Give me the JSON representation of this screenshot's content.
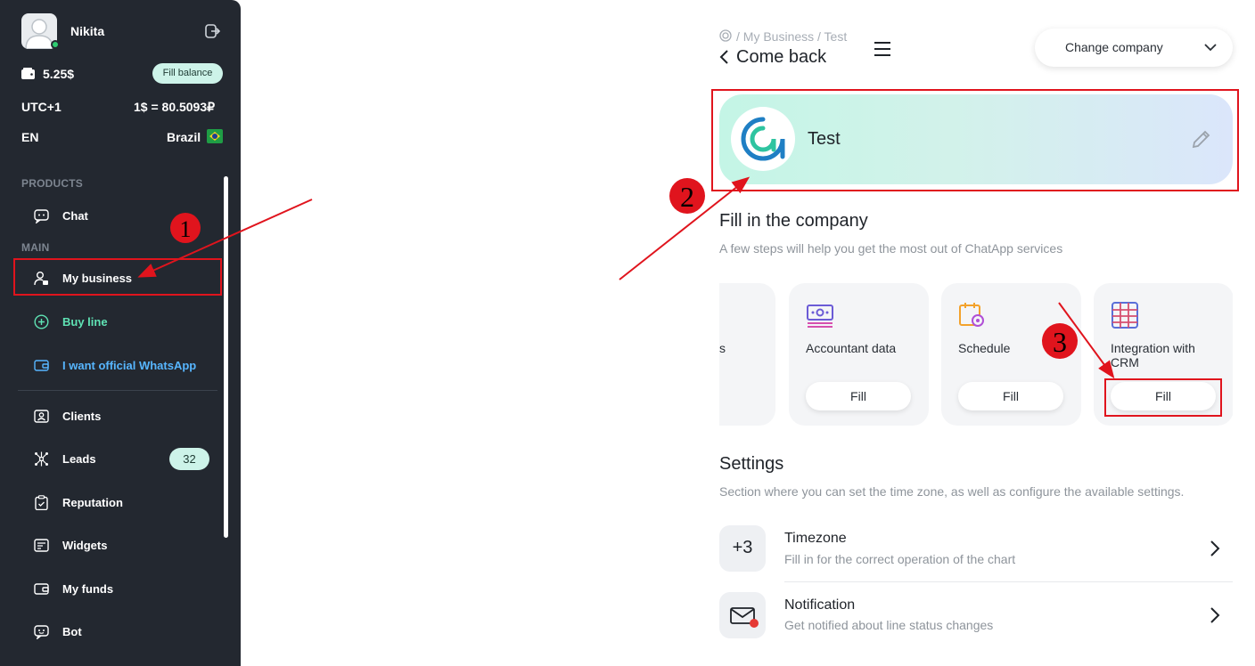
{
  "sidebar": {
    "user": {
      "name": "Nikita",
      "avatar_icon": "avatar-placeholder-icon",
      "status_color": "#2ecc71"
    },
    "balance": "5.25$",
    "fill_balance": "Fill balance",
    "timezone": "UTC+1",
    "rate": "1$ = 80.5093₽",
    "language": "EN",
    "country": "Brazil",
    "sections": {
      "products": "PRODUCTS",
      "main": "MAIN"
    },
    "items": [
      {
        "label": "Chat",
        "icon": "chat-icon"
      },
      {
        "label": "My business",
        "icon": "business-icon"
      },
      {
        "label": "Buy line",
        "icon": "plus-circle-icon"
      },
      {
        "label": "I want official WhatsApp",
        "icon": "wallet-icon"
      },
      {
        "label": "Clients",
        "icon": "id-card-icon"
      },
      {
        "label": "Leads",
        "icon": "network-icon",
        "badge": "32"
      },
      {
        "label": "Reputation",
        "icon": "clipboard-icon"
      },
      {
        "label": "Widgets",
        "icon": "widget-icon"
      },
      {
        "label": "My funds",
        "icon": "wallet-icon"
      },
      {
        "label": "Bot",
        "icon": "bot-icon"
      }
    ]
  },
  "header": {
    "breadcrumb": "/ My Business  /  Test",
    "back": "Come back",
    "change_company": "Change company"
  },
  "company": {
    "name": "Test"
  },
  "fill": {
    "title": "Fill in the company",
    "subtitle": "A few steps will help you get the most out of ChatApp services",
    "partial_label": "s",
    "steps": [
      {
        "label": "Accountant data",
        "button": "Fill",
        "icon": "accountant-icon"
      },
      {
        "label": "Schedule",
        "button": "Fill",
        "icon": "schedule-icon"
      },
      {
        "label": "Integration with CRM",
        "button": "Fill",
        "icon": "crm-table-icon"
      }
    ]
  },
  "settings": {
    "title": "Settings",
    "subtitle": "Section where you can set the time zone, as well as configure the available settings.",
    "rows": [
      {
        "icon_text": "+3",
        "title": "Timezone",
        "subtitle": "Fill in for the correct operation of the chart"
      },
      {
        "icon_text": "",
        "title": "Notification",
        "subtitle": "Get notified about line status changes"
      }
    ]
  },
  "annotations": {
    "step1": "1",
    "step2": "2",
    "step3": "3",
    "color": "#e0141d"
  },
  "colors": {
    "sidebar_bg": "#232830",
    "accent_green": "#5fe3b4",
    "accent_blue": "#57b6ff",
    "highlight_red": "#e0141d"
  }
}
